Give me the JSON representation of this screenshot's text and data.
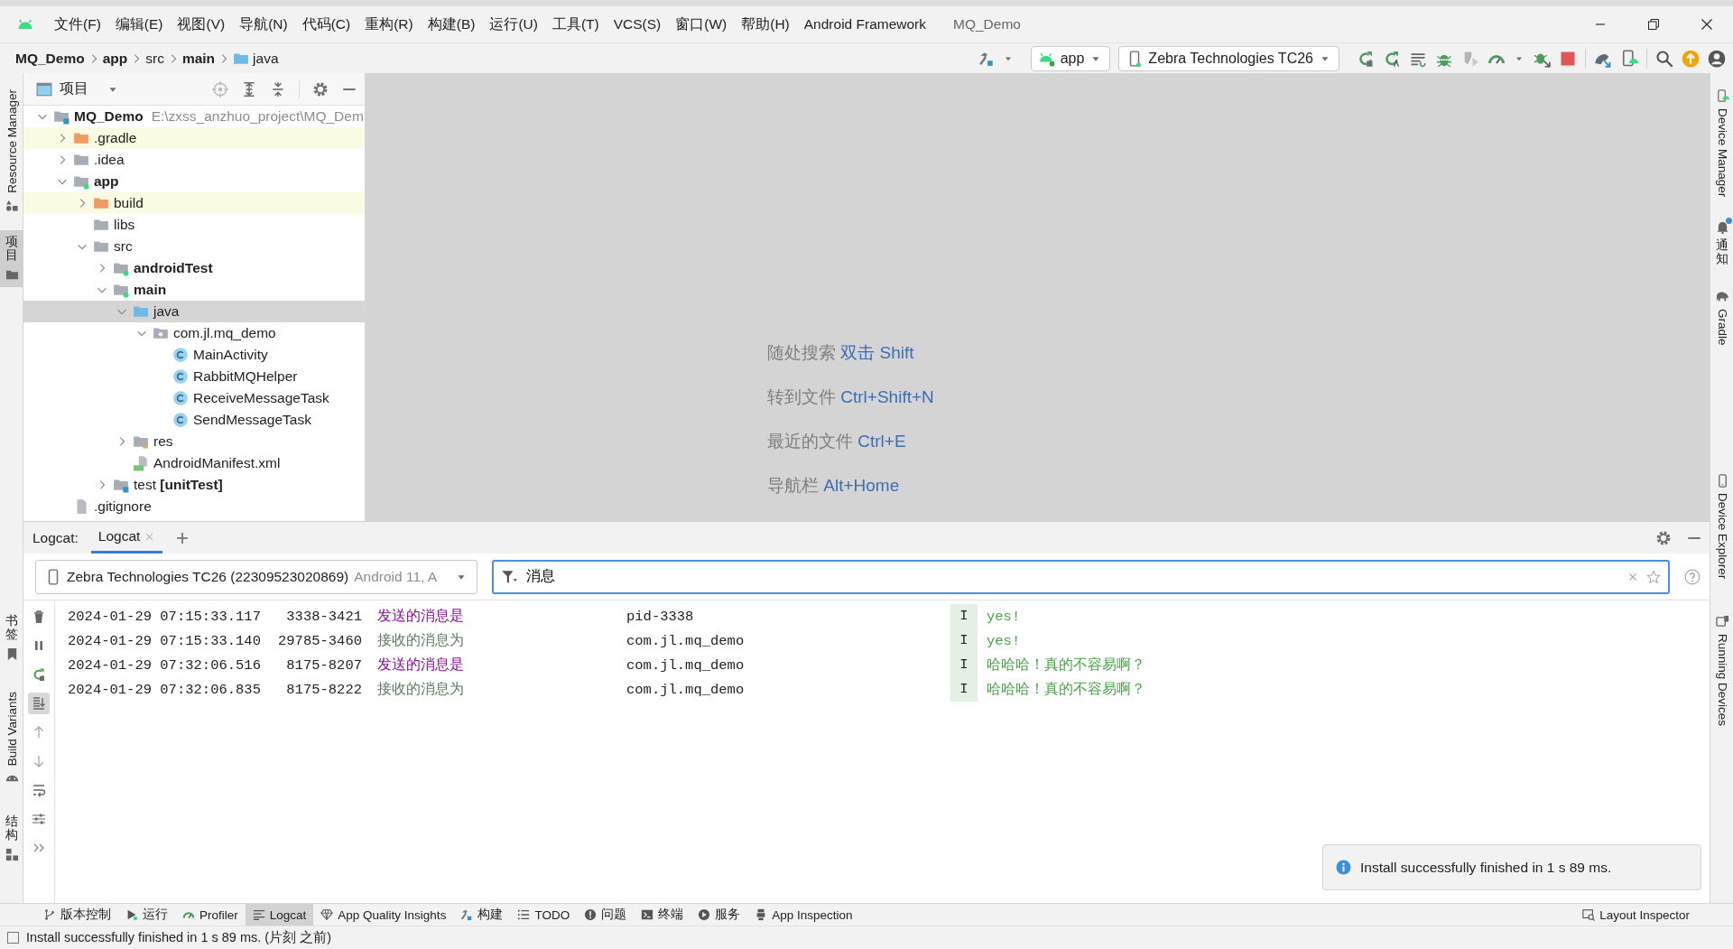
{
  "window": {
    "title": "MQ_Demo"
  },
  "menu": [
    "文件(F)",
    "编辑(E)",
    "视图(V)",
    "导航(N)",
    "代码(C)",
    "重构(R)",
    "构建(B)",
    "运行(U)",
    "工具(T)",
    "VCS(S)",
    "窗口(W)",
    "帮助(H)",
    "Android Framework"
  ],
  "breadcrumb": [
    {
      "label": "MQ_Demo",
      "bold": true,
      "kind": "plain"
    },
    {
      "label": "app",
      "bold": true,
      "kind": "plain"
    },
    {
      "label": "src",
      "bold": false,
      "kind": "plain"
    },
    {
      "label": "main",
      "bold": true,
      "kind": "plain"
    },
    {
      "label": "java",
      "bold": false,
      "kind": "folder"
    }
  ],
  "toolbar": {
    "run_config": "app",
    "device": "Zebra Technologies TC26"
  },
  "left_stripe": {
    "top": [
      {
        "label": "Resource Manager",
        "kind": "resources",
        "selected": false
      },
      {
        "label": "项目",
        "kind": "project",
        "selected": true
      }
    ],
    "bottom": [
      {
        "label": "书签",
        "kind": "bookmarks",
        "selected": false
      },
      {
        "label": "Build Variants",
        "kind": "variants",
        "selected": false
      },
      {
        "label": "结构",
        "kind": "structure",
        "selected": false
      }
    ]
  },
  "right_stripe": {
    "top": [
      {
        "label": "Device Manager",
        "kind": "device-manager",
        "unread": false
      },
      {
        "label": "通知",
        "kind": "notifications",
        "unread": true
      },
      {
        "label": "Gradle",
        "kind": "gradle",
        "unread": false
      }
    ],
    "bottom": [
      {
        "label": "Device Explorer",
        "kind": "device-explorer",
        "unread": false
      },
      {
        "label": "Running Devices",
        "kind": "running-devices",
        "unread": false
      }
    ]
  },
  "project_panel": {
    "title": "项目",
    "tree": [
      {
        "label": "MQ_Demo",
        "detail": "E:\\zxss_anzhuo_project\\MQ_Dem",
        "kind": "root",
        "bold": true,
        "selected": false,
        "expanded": true,
        "children": [
          {
            "label": ".gradle",
            "kind": "excluded",
            "bold": false,
            "selected": false,
            "expanded": false
          },
          {
            "label": ".idea",
            "kind": "folder",
            "bold": false,
            "selected": false,
            "expanded": false
          },
          {
            "label": "app",
            "kind": "module",
            "bold": true,
            "selected": false,
            "expanded": true,
            "children": [
              {
                "label": "build",
                "kind": "excluded",
                "bold": false,
                "selected": false,
                "expanded": false
              },
              {
                "label": "libs",
                "kind": "folder",
                "bold": false,
                "selected": false
              },
              {
                "label": "src",
                "kind": "folder",
                "bold": false,
                "selected": false,
                "expanded": true,
                "children": [
                  {
                    "label": "androidTest",
                    "kind": "module",
                    "bold": true,
                    "selected": false,
                    "expanded": false
                  },
                  {
                    "label": "main",
                    "kind": "module",
                    "bold": true,
                    "selected": false,
                    "expanded": true,
                    "children": [
                      {
                        "label": "java",
                        "kind": "source",
                        "bold": false,
                        "selected": true,
                        "expanded": true,
                        "children": [
                          {
                            "label": "com.jl.mq_demo",
                            "kind": "package",
                            "bold": false,
                            "selected": false,
                            "expanded": true,
                            "children": [
                              {
                                "label": "MainActivity",
                                "kind": "class",
                                "bold": false,
                                "selected": false
                              },
                              {
                                "label": "RabbitMQHelper",
                                "kind": "class",
                                "bold": false,
                                "selected": false
                              },
                              {
                                "label": "ReceiveMessageTask",
                                "kind": "class",
                                "bold": false,
                                "selected": false
                              },
                              {
                                "label": "SendMessageTask",
                                "kind": "class",
                                "bold": false,
                                "selected": false
                              }
                            ]
                          }
                        ]
                      },
                      {
                        "label": "res",
                        "kind": "resources",
                        "bold": false,
                        "selected": false,
                        "expanded": false
                      },
                      {
                        "label": "AndroidManifest.xml",
                        "kind": "manifest",
                        "bold": false,
                        "selected": false
                      }
                    ]
                  },
                  {
                    "label": "test **[unitTest]**",
                    "kind": "test",
                    "bold": false,
                    "selected": false,
                    "expanded": false
                  }
                ]
              }
            ]
          },
          {
            "label": ".gitignore",
            "kind": "file",
            "bold": false,
            "selected": false
          }
        ]
      }
    ]
  },
  "editor": {
    "hints": [
      {
        "action": "随处搜索",
        "shortcut": "双击 Shift"
      },
      {
        "action": "转到文件",
        "shortcut": "Ctrl+Shift+N"
      },
      {
        "action": "最近的文件",
        "shortcut": "Ctrl+E"
      },
      {
        "action": "导航栏",
        "shortcut": "Alt+Home"
      }
    ]
  },
  "logcat": {
    "label": "Logcat:",
    "tabs": [
      {
        "label": "Logcat",
        "selected": true
      }
    ],
    "device": "Zebra Technologies TC26 (22309523020869)",
    "device_detail": "Android 11, A",
    "filter": "消息",
    "toolbar": [
      {
        "kind": "clear",
        "on": false
      },
      {
        "kind": "pause",
        "on": false
      },
      {
        "kind": "restart",
        "on": false
      },
      {
        "kind": "scroll-end",
        "on": true
      },
      {
        "kind": "up",
        "on": false
      },
      {
        "kind": "down",
        "on": false
      },
      {
        "kind": "wrap",
        "on": false
      },
      {
        "kind": "format",
        "on": false
      },
      {
        "kind": "more",
        "on": false
      }
    ],
    "rows": [
      {
        "time": "2024-01-29 07:15:33.117",
        "pid": "3338-3421",
        "tag": "发送的消息是",
        "color": "#871094",
        "package": "pid-3338",
        "level": "I",
        "message": "yes!"
      },
      {
        "time": "2024-01-29 07:15:33.140",
        "pid": "29785-3460",
        "tag": "接收的消息为",
        "color": "#5f7a62",
        "package": "com.jl.mq_demo",
        "level": "I",
        "message": "yes!"
      },
      {
        "time": "2024-01-29 07:32:06.516",
        "pid": "8175-8207",
        "tag": "发送的消息是",
        "color": "#871094",
        "package": "com.jl.mq_demo",
        "level": "I",
        "message": "哈哈哈！真的不容易啊？"
      },
      {
        "time": "2024-01-29 07:32:06.835",
        "pid": "8175-8222",
        "tag": "接收的消息为",
        "color": "#5f7a62",
        "package": "com.jl.mq_demo",
        "level": "I",
        "message": "哈哈哈！真的不容易啊？"
      }
    ]
  },
  "notification": {
    "text": "Install successfully finished in 1 s 89 ms."
  },
  "tool_strip": {
    "left": [
      {
        "label": "版本控制",
        "kind": "vcs",
        "selected": false
      },
      {
        "label": "运行",
        "kind": "run",
        "selected": false
      },
      {
        "label": "Profiler",
        "kind": "profiler",
        "selected": false
      },
      {
        "label": "Logcat",
        "kind": "logcat",
        "selected": true
      },
      {
        "label": "App Quality Insights",
        "kind": "insights",
        "selected": false
      },
      {
        "label": "构建",
        "kind": "build",
        "selected": false
      },
      {
        "label": "TODO",
        "kind": "todo",
        "selected": false
      },
      {
        "label": "问题",
        "kind": "problems",
        "selected": false
      },
      {
        "label": "终端",
        "kind": "terminal",
        "selected": false
      },
      {
        "label": "服务",
        "kind": "services",
        "selected": false
      },
      {
        "label": "App Inspection",
        "kind": "inspection",
        "selected": false
      }
    ],
    "right": [
      {
        "label": "Layout Inspector",
        "kind": "layout",
        "selected": false
      }
    ]
  },
  "status_bar": {
    "message": "Install successfully finished in 1 s 89 ms. (片刻 之前)"
  }
}
